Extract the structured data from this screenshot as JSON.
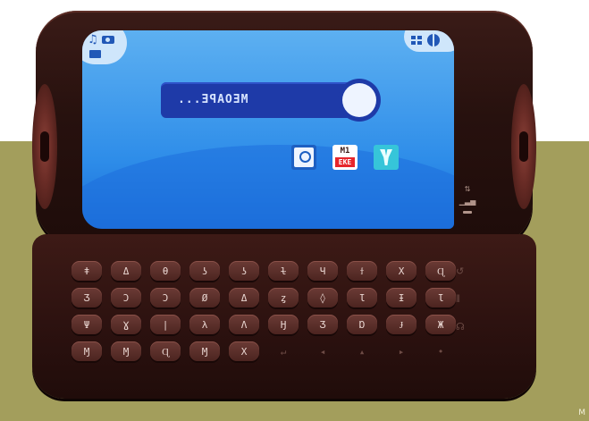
{
  "screen": {
    "search_text": "MEOAPE...",
    "status_icons": [
      "music-icon",
      "camera-icon",
      "message-icon",
      "grid-icon",
      "globe-icon"
    ],
    "apps": [
      {
        "name": "video-app-icon"
      },
      {
        "name": "calendar-app-icon",
        "top": "M1",
        "bottom": "EKE"
      },
      {
        "name": "tools-app-icon"
      }
    ]
  },
  "keyboard": {
    "rows": [
      [
        "ǂ",
        "Δ",
        "θ",
        "ʖ",
        "ʖ",
        "ɫ",
        "Ɥ",
        "ϯ",
        "Χ",
        "Ɋ"
      ],
      [
        "Ʒ",
        "Ɔ",
        "Ɔ",
        "Ø",
        "Δ",
        "ȥ",
        "◊",
        "Ɩ",
        "Ɨ",
        "Ɩ"
      ],
      [
        "Ψ",
        "Ɣ",
        "|",
        "λ",
        "Λ",
        "Ӈ",
        "Ӡ",
        "Ɒ",
        "Ɉ",
        "Ж"
      ],
      [
        "Ɱ",
        "Ɱ",
        "Ɋ",
        "Ɱ",
        "Χ",
        "↵",
        "◂",
        "▴",
        "▸",
        "•"
      ]
    ],
    "side_keys": [
      "↺",
      "⦀",
      "☊"
    ]
  },
  "colors": {
    "background_band": "#a39e5c",
    "phone_body": "#2b110f",
    "screen": "#2e8de9",
    "search_field": "#1e3aa8"
  },
  "watermark": "M"
}
